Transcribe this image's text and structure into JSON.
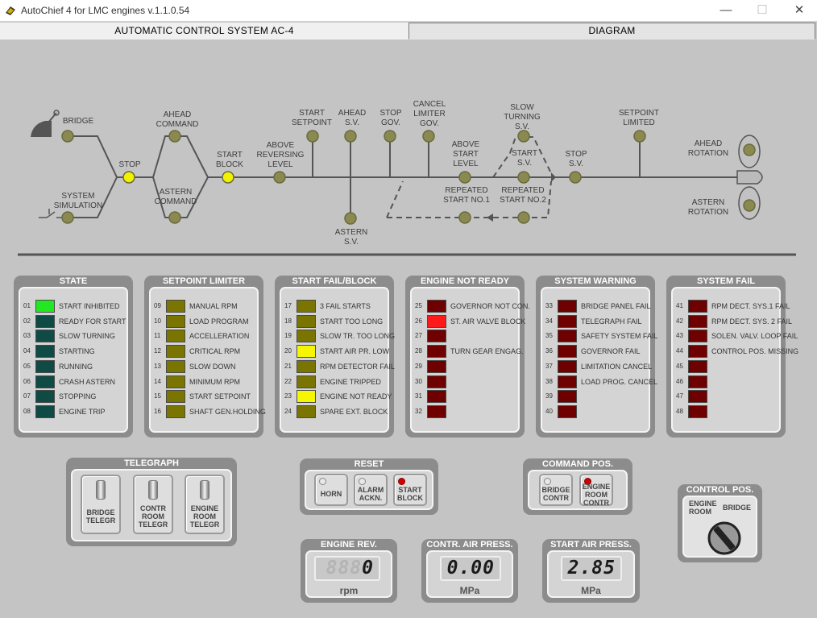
{
  "window": {
    "title": "AutoChief 4 for LMC engines  v.1.1.0.54",
    "min": "—",
    "max": "☐",
    "close": "✕"
  },
  "tabs": [
    {
      "label": "AUTOMATIC CONTROL SYSTEM AC-4"
    },
    {
      "label": "DIAGRAM"
    }
  ],
  "diagram": {
    "bridge": "BRIDGE",
    "system_simulation": "SYSTEM\nSIMULATION",
    "stop": "STOP",
    "ahead_command": "AHEAD\nCOMMAND",
    "astern_command": "ASTERN\nCOMMAND",
    "start_block": "START\nBLOCK",
    "above_reversing_level": "ABOVE\nREVERSING\nLEVEL",
    "start_setpoint": "START\nSETPOINT",
    "ahead_sv": "AHEAD\nS.V.",
    "astern_sv": "ASTERN\nS.V.",
    "stop_gov": "STOP\nGOV.",
    "cancel_limiter_gov": "CANCEL\nLIMITER\nGOV.",
    "above_start_level": "ABOVE\nSTART\nLEVEL",
    "repeated_start_1": "REPEATED\nSTART NO.1",
    "slow_turning_sv": "SLOW\nTURNING\nS.V.",
    "start_sv": "START\nS.V.",
    "repeated_start_2": "REPEATED\nSTART NO.2",
    "stop_sv": "STOP\nS.V.",
    "setpoint_limited": "SETPOINT\nLIMITED",
    "ahead_rotation": "AHEAD\nROTATION",
    "astern_rotation": "ASTERN\nROTATION"
  },
  "colors": {
    "off_green": "#0f4a44",
    "on_green": "#22e822",
    "off_olive": "#7a7400",
    "on_yellow": "#f6f600",
    "off_red": "#6e0000",
    "on_red": "#ff1a1a",
    "node": "#8a8a50",
    "node_active": "#f2f200"
  },
  "panels": [
    {
      "title": "STATE",
      "items": [
        {
          "num": "01",
          "label": "START INHIBITED",
          "state": "on"
        },
        {
          "num": "02",
          "label": "READY FOR START",
          "state": "off"
        },
        {
          "num": "03",
          "label": "SLOW TURNING",
          "state": "off"
        },
        {
          "num": "04",
          "label": "STARTING",
          "state": "off"
        },
        {
          "num": "05",
          "label": "RUNNING",
          "state": "off"
        },
        {
          "num": "06",
          "label": "CRASH ASTERN",
          "state": "off"
        },
        {
          "num": "07",
          "label": "STOPPING",
          "state": "off"
        },
        {
          "num": "08",
          "label": "ENGINE TRIP",
          "state": "off"
        }
      ]
    },
    {
      "title": "SETPOINT LIMITER",
      "items": [
        {
          "num": "09",
          "label": "MANUAL RPM",
          "state": "off"
        },
        {
          "num": "10",
          "label": "LOAD PROGRAM",
          "state": "off"
        },
        {
          "num": "11",
          "label": "ACCELLERATION",
          "state": "off"
        },
        {
          "num": "12",
          "label": "CRITICAL RPM",
          "state": "off"
        },
        {
          "num": "13",
          "label": "SLOW DOWN",
          "state": "off"
        },
        {
          "num": "14",
          "label": "MINIMUM RPM",
          "state": "off"
        },
        {
          "num": "15",
          "label": "START SETPOINT",
          "state": "off"
        },
        {
          "num": "16",
          "label": "SHAFT GEN.HOLDING",
          "state": "off"
        }
      ]
    },
    {
      "title": "START FAIL/BLOCK",
      "items": [
        {
          "num": "17",
          "label": "3 FAIL STARTS",
          "state": "off"
        },
        {
          "num": "18",
          "label": "START TOO LONG",
          "state": "off"
        },
        {
          "num": "19",
          "label": "SLOW TR. TOO LONG",
          "state": "off"
        },
        {
          "num": "20",
          "label": "START AIR PR. LOW",
          "state": "on"
        },
        {
          "num": "21",
          "label": "RPM DETECTOR FAIL",
          "state": "off"
        },
        {
          "num": "22",
          "label": "ENGINE TRIPPED",
          "state": "off"
        },
        {
          "num": "23",
          "label": "ENGINE NOT READY",
          "state": "on"
        },
        {
          "num": "24",
          "label": "SPARE EXT. BLOCK",
          "state": "off"
        }
      ]
    },
    {
      "title": "ENGINE NOT READY",
      "items": [
        {
          "num": "25",
          "label": "GOVERNOR NOT CON.",
          "state": "off"
        },
        {
          "num": "26",
          "label": "ST. AIR VALVE BLOCK",
          "state": "on"
        },
        {
          "num": "27",
          "label": "",
          "state": "off"
        },
        {
          "num": "28",
          "label": "TURN GEAR ENGAG.",
          "state": "off"
        },
        {
          "num": "29",
          "label": "",
          "state": "off"
        },
        {
          "num": "30",
          "label": "",
          "state": "off"
        },
        {
          "num": "31",
          "label": "",
          "state": "off"
        },
        {
          "num": "32",
          "label": "",
          "state": "off"
        }
      ]
    },
    {
      "title": "SYSTEM WARNING",
      "items": [
        {
          "num": "33",
          "label": "BRIDGE PANEL FAIL",
          "state": "off"
        },
        {
          "num": "34",
          "label": "TELEGRAPH FAIL",
          "state": "off"
        },
        {
          "num": "35",
          "label": "SAFETY SYSTEM FAIL",
          "state": "off"
        },
        {
          "num": "36",
          "label": "GOVERNOR FAIL",
          "state": "off"
        },
        {
          "num": "37",
          "label": "LIMITATION CANCEL",
          "state": "off"
        },
        {
          "num": "38",
          "label": "LOAD PROG. CANCEL",
          "state": "off"
        },
        {
          "num": "39",
          "label": "",
          "state": "off"
        },
        {
          "num": "40",
          "label": "",
          "state": "off"
        }
      ]
    },
    {
      "title": "SYSTEM FAIL",
      "items": [
        {
          "num": "41",
          "label": "RPM DECT. SYS.1 FAIL",
          "state": "off"
        },
        {
          "num": "42",
          "label": "RPM DECT. SYS. 2 FAIL",
          "state": "off"
        },
        {
          "num": "43",
          "label": "SOLEN. VALV. LOOP FAIL",
          "state": "off"
        },
        {
          "num": "44",
          "label": "CONTROL POS. MISSING",
          "state": "off"
        },
        {
          "num": "45",
          "label": "",
          "state": "off"
        },
        {
          "num": "46",
          "label": "",
          "state": "off"
        },
        {
          "num": "47",
          "label": "",
          "state": "off"
        },
        {
          "num": "48",
          "label": "",
          "state": "off"
        }
      ]
    }
  ],
  "telegraph": {
    "title": "TELEGRAPH",
    "bridge": "BRIDGE\nTELEGR",
    "contr_room": "CONTR\nROOM\nTELEGR",
    "engine_room": "ENGINE\nROOM\nTELEGR"
  },
  "reset": {
    "title": "RESET",
    "horn": "HORN",
    "alarm_ackn": "ALARM\nACKN.",
    "start_block": "START\nBLOCK"
  },
  "command_pos": {
    "title": "COMMAND POS.",
    "bridge_contr": "BRIDGE\nCONTR",
    "engine_room_contr": "ENGINE\nROOM\nCONTR"
  },
  "control_pos": {
    "title": "CONTROL POS.",
    "engine_room": "ENGINE\nROOM",
    "bridge": "BRIDGE"
  },
  "engine_rev": {
    "title": "ENGINE REV.",
    "ghost": "888",
    "value": "0",
    "unit": "rpm"
  },
  "contr_air_press": {
    "title": "CONTR. AIR PRESS.",
    "value": "0.00",
    "unit": "MPa"
  },
  "start_air_press": {
    "title": "START AIR PRESS.",
    "value": "2.85",
    "unit": "MPa"
  }
}
